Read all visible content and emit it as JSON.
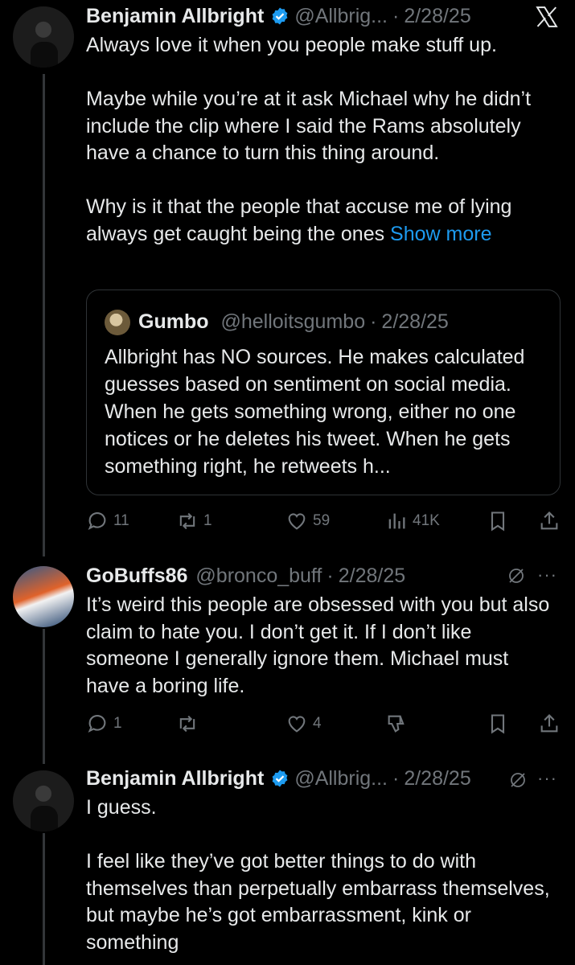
{
  "tweets": [
    {
      "name": "Benjamin Allbright",
      "handle": "@Allbrig...",
      "date": "2/28/25",
      "text": "Always love it when you people make stuff up.\n\nMaybe while you’re at it ask Michael why he didn’t include the clip where I said the Rams absolutely have a chance to turn this thing around.\n\nWhy is it that the people that accuse me of lying always get caught being the ones ",
      "show_more": "Show more",
      "quote": {
        "name": "Gumbo",
        "handle": "@helloitsgumbo",
        "date": "2/28/25",
        "text": "Allbright has NO sources. He makes calculated guesses based on sentiment on social media. When he gets something wrong, either no one notices or he deletes his tweet. When he gets something right, he retweets h..."
      },
      "stats": {
        "replies": "11",
        "reposts": "1",
        "likes": "59",
        "views": "41K"
      }
    },
    {
      "name": "GoBuffs86",
      "handle": "@bronco_buff",
      "date": "2/28/25",
      "text": "It’s weird this people are obsessed with you but also claim to hate you. I don’t get it. If I don’t like someone I generally ignore them. Michael must have a boring life.",
      "stats": {
        "replies": "1",
        "likes": "4"
      }
    },
    {
      "name": "Benjamin Allbright",
      "handle": "@Allbrig...",
      "date": "2/28/25",
      "text": "I guess.\n\nI feel like they’ve got better things to do with themselves than perpetually embarrass themselves, but maybe he’s got embarrassment, kink or something"
    }
  ],
  "dot": "·",
  "more_glyph": "···",
  "colors": {
    "background": "#000000",
    "text": "#e7e9ea",
    "muted": "#71767b",
    "link": "#1d9bf0",
    "verified": "#1d9bf0"
  }
}
